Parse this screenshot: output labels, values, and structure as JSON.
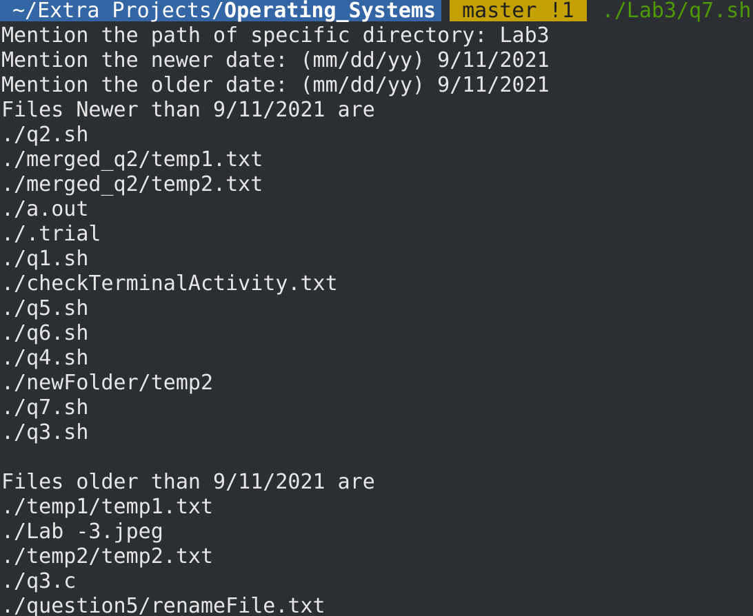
{
  "prompt": {
    "path_prefix": "~/Extra Projects/",
    "path_bold": "Operating_Systems",
    "git_branch": "master !1",
    "command": "./Lab3/q7.sh"
  },
  "colors": {
    "background": "#2b2f33",
    "path_segment": "#3465a4",
    "git_segment": "#c4a000",
    "command_text": "#4e9a06",
    "text": "#e6e6e6"
  },
  "output_lines": [
    "Mention the path of specific directory: Lab3",
    "Mention the newer date: (mm/dd/yy) 9/11/2021",
    "Mention the older date: (mm/dd/yy) 9/11/2021",
    "Files Newer than 9/11/2021 are",
    "./q2.sh",
    "./merged_q2/temp1.txt",
    "./merged_q2/temp2.txt",
    "./a.out",
    "./.trial",
    "./q1.sh",
    "./checkTerminalActivity.txt",
    "./q5.sh",
    "./q6.sh",
    "./q4.sh",
    "./newFolder/temp2",
    "./q7.sh",
    "./q3.sh",
    "",
    "Files older than 9/11/2021 are",
    "./temp1/temp1.txt",
    "./Lab -3.jpeg",
    "./temp2/temp2.txt",
    "./q3.c",
    "./question5/renameFile.txt"
  ]
}
